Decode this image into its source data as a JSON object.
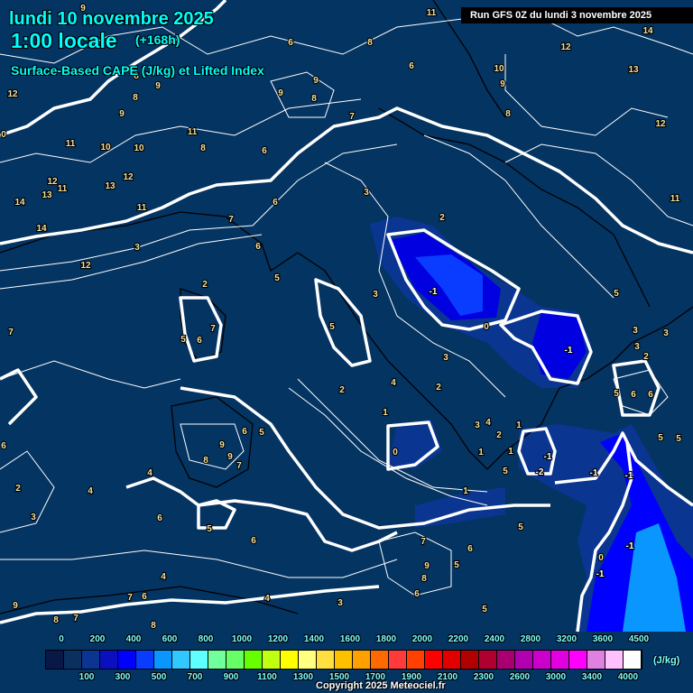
{
  "header": {
    "date": "lundi 10 novembre 2025",
    "hour": "1:00 locale",
    "lead": "(+168h)",
    "parameter": "Surface-Based CAPE (J/kg) et Lifted Index",
    "run": "Run GFS 0Z du lundi 3 novembre 2025"
  },
  "colors": {
    "background": "#043462",
    "cape_low": "#0a3590",
    "cape_mid": "#0000ff",
    "cape_high": "#0a96ff",
    "contour": "#ffffff",
    "coast": "#000000"
  },
  "lifted_index_labels": [
    "9",
    "11",
    "14",
    "6",
    "8",
    "12",
    "6",
    "10",
    "13",
    "8",
    "9",
    "9",
    "9",
    "8",
    "9",
    "12",
    "8",
    "9",
    "7",
    "8",
    "12",
    "11",
    "0",
    "11",
    "10",
    "10",
    "8",
    "6",
    "12",
    "12",
    "13",
    "13",
    "11",
    "14",
    "3",
    "6",
    "11",
    "11",
    "14",
    "7",
    "2",
    "6",
    "3",
    "12",
    "5",
    "2",
    "3",
    "-1",
    "5",
    "7",
    "5",
    "0",
    "5",
    "6",
    "3",
    "7",
    "3",
    "-1",
    "3",
    "2",
    "3",
    "4",
    "2",
    "1",
    "2",
    "5",
    "6",
    "6",
    "3",
    "4",
    "1",
    "6",
    "5",
    "2",
    "9",
    "8",
    "9",
    "7",
    "0",
    "5",
    "5",
    "6",
    "1",
    "-1",
    "1",
    "5",
    "4",
    "-1",
    "-1",
    "2",
    "-2",
    "4",
    "1",
    "3",
    "6",
    "5",
    "5",
    "6",
    "7",
    "6",
    "-1",
    "0",
    "9",
    "8",
    "-1",
    "4",
    "5",
    "7",
    "6",
    "6",
    "4",
    "3",
    "9",
    "5",
    "8",
    "7",
    "8"
  ],
  "legend": {
    "top_labels": [
      "0",
      "200",
      "400",
      "600",
      "800",
      "1000",
      "1200",
      "1400",
      "1600",
      "1800",
      "2000",
      "2200",
      "2400",
      "2800",
      "3200",
      "3600",
      "4500"
    ],
    "bottom_labels": [
      "100",
      "300",
      "500",
      "700",
      "900",
      "1100",
      "1300",
      "1500",
      "1700",
      "1900",
      "2100",
      "2300",
      "2600",
      "3000",
      "3400",
      "4000"
    ],
    "colors": [
      "#0a1848",
      "#0a3060",
      "#0a3590",
      "#0a10c0",
      "#0000ff",
      "#0a3cff",
      "#0a96ff",
      "#30c8ff",
      "#60ffff",
      "#70ff9a",
      "#66ff66",
      "#66ff00",
      "#c0ff10",
      "#ffff00",
      "#ffff80",
      "#ffe040",
      "#ffc000",
      "#ffa000",
      "#ff6a00",
      "#ff3a3a",
      "#ff4000",
      "#ff0000",
      "#e00000",
      "#b00000",
      "#b00030",
      "#a80070",
      "#b000b0",
      "#cc00cc",
      "#e000e0",
      "#ff00ff",
      "#e080e0",
      "#ffc0ff",
      "#ffffff"
    ],
    "unit": "(J/kg)"
  },
  "copyright": "Copyright 2025 Meteociel.fr"
}
